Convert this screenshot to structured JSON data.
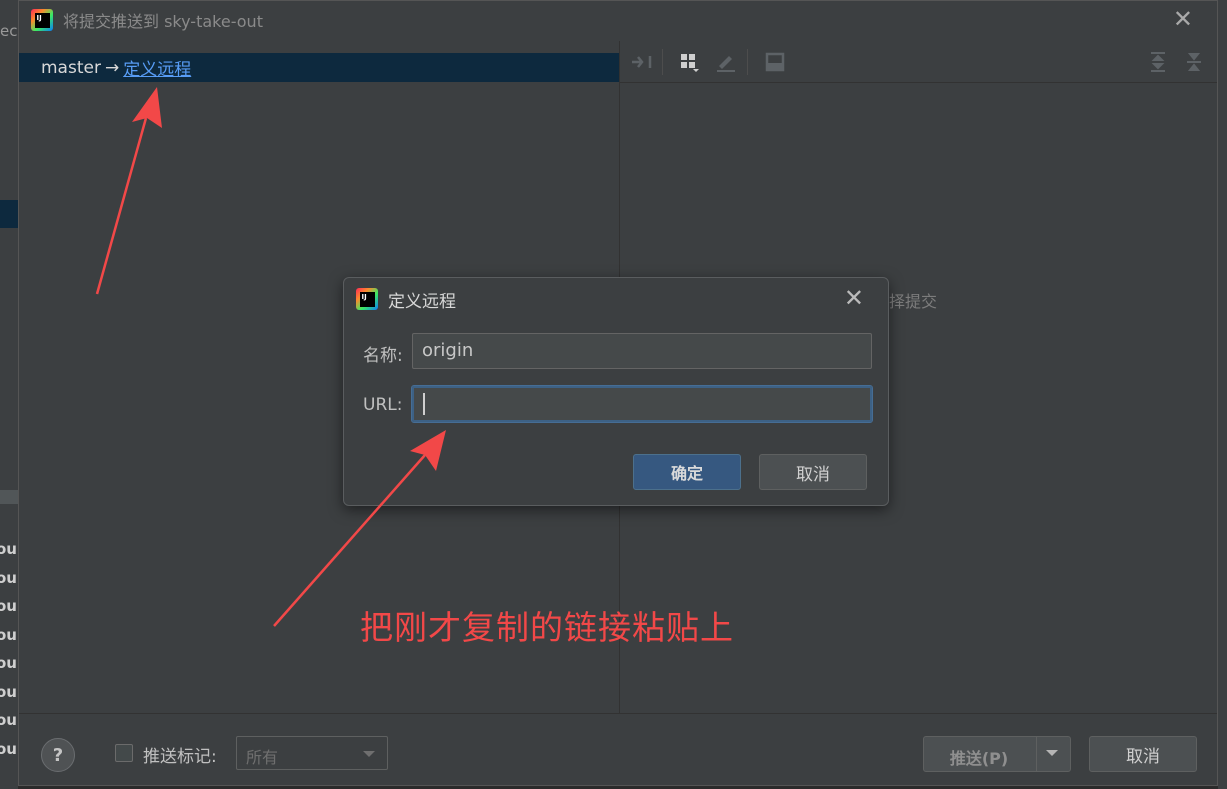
{
  "background": {
    "left_fragment_text": "ec",
    "left_rows": [
      "ou",
      "ou",
      "ou",
      "ou",
      "ou",
      "ou",
      "ou",
      "ou"
    ]
  },
  "push_dialog": {
    "title": "将提交推送到 sky-take-out",
    "branch": "master",
    "arrow": "→",
    "define_remote_link": "定义远程",
    "empty_text": "选择提交",
    "footer": {
      "help": "?",
      "push_tags_label": "推送标记:",
      "tags_value": "所有",
      "push_button": "推送(P)",
      "cancel_button": "取消"
    }
  },
  "remote_dialog": {
    "title": "定义远程",
    "name_label": "名称:",
    "name_value": "origin",
    "url_label": "URL:",
    "url_value": "",
    "ok_button": "确定",
    "cancel_button": "取消"
  },
  "annotation": {
    "text": "把刚才复制的链接粘贴上",
    "color": "#f24848"
  },
  "logo_text": "IJ"
}
